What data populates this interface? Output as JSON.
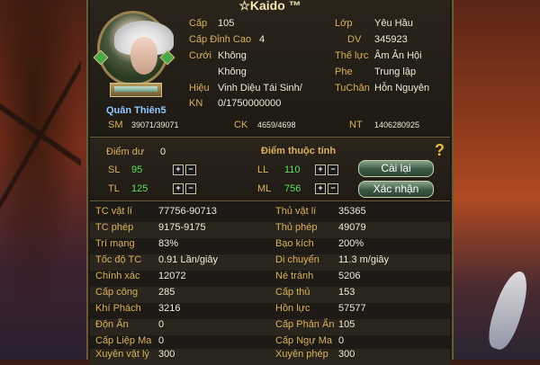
{
  "character": {
    "name": "Kaido ™",
    "name_prefix": "☆",
    "title": "Quân Thiên5",
    "avatar": "white-haired-character-portrait",
    "info_left": [
      {
        "label": "Cấp",
        "value": "105"
      },
      {
        "label": "Cấp Đỉnh Cao",
        "value": "4"
      },
      {
        "label": "Cưới",
        "value": "Không"
      },
      {
        "label": "",
        "value": "Không"
      },
      {
        "label": "Hiệu",
        "value": "Vinh Diệu Tái Sinh/"
      },
      {
        "label": "KN",
        "value": "0/1750000000"
      }
    ],
    "info_right": [
      {
        "label": "Lớp",
        "value": "Yêu Hầu"
      },
      {
        "label": "DV",
        "value": "345923"
      },
      {
        "label": "Thế lực",
        "value": "Âm Ản Hội"
      },
      {
        "label": "Phe",
        "value": "Trung lập"
      },
      {
        "label": "TuChân",
        "value": "Hỗn Nguyên"
      }
    ],
    "vitals": [
      {
        "label": "SM",
        "value": "39071/39071"
      },
      {
        "label": "CK",
        "value": "4659/4698"
      },
      {
        "label": "NT",
        "value": "1406280925"
      }
    ]
  },
  "attributes": {
    "free_points_label": "Điểm dư",
    "free_points": "0",
    "section_title": "Điểm thuộc tính",
    "help_icon": "?",
    "stats": [
      {
        "label": "SL",
        "value": "95"
      },
      {
        "label": "TL",
        "value": "125"
      },
      {
        "label": "LL",
        "value": "110"
      },
      {
        "label": "ML",
        "value": "756"
      }
    ],
    "plus_symbol": "+",
    "minus_symbol": "−",
    "reset_label": "Cài lại",
    "confirm_label": "Xác nhận"
  },
  "details": {
    "left": [
      {
        "label": "TC vật lí",
        "value": "77756-90713"
      },
      {
        "label": "TC phép",
        "value": "9175-9175"
      },
      {
        "label": "Trí mạng",
        "value": "83%"
      },
      {
        "label": "Tốc độ TC",
        "value": "0.91 Lần/giây"
      },
      {
        "label": "Chính xác",
        "value": "12072"
      },
      {
        "label": "Cấp công",
        "value": "285"
      },
      {
        "label": "Khí Phách",
        "value": "3216"
      },
      {
        "label": "Độn Ẩn",
        "value": "0"
      },
      {
        "label": "Cấp Liệp Ma",
        "value": "0"
      },
      {
        "label": "Xuyên vật lý",
        "value": "300"
      }
    ],
    "right": [
      {
        "label": "Thủ vật lí",
        "value": "35365"
      },
      {
        "label": "Thủ phép",
        "value": "49079"
      },
      {
        "label": "Bạo kích",
        "value": "200%"
      },
      {
        "label": "Di chuyển",
        "value": "11.3 m/giây"
      },
      {
        "label": "Né tránh",
        "value": "5206"
      },
      {
        "label": "Cấp thủ",
        "value": "153"
      },
      {
        "label": "Hồn lực",
        "value": "57577"
      },
      {
        "label": "Cấp Phản Ẩn",
        "value": "105"
      },
      {
        "label": "Cấp Ngự Ma",
        "value": "0"
      },
      {
        "label": "Xuyên phép",
        "value": "300"
      }
    ]
  }
}
